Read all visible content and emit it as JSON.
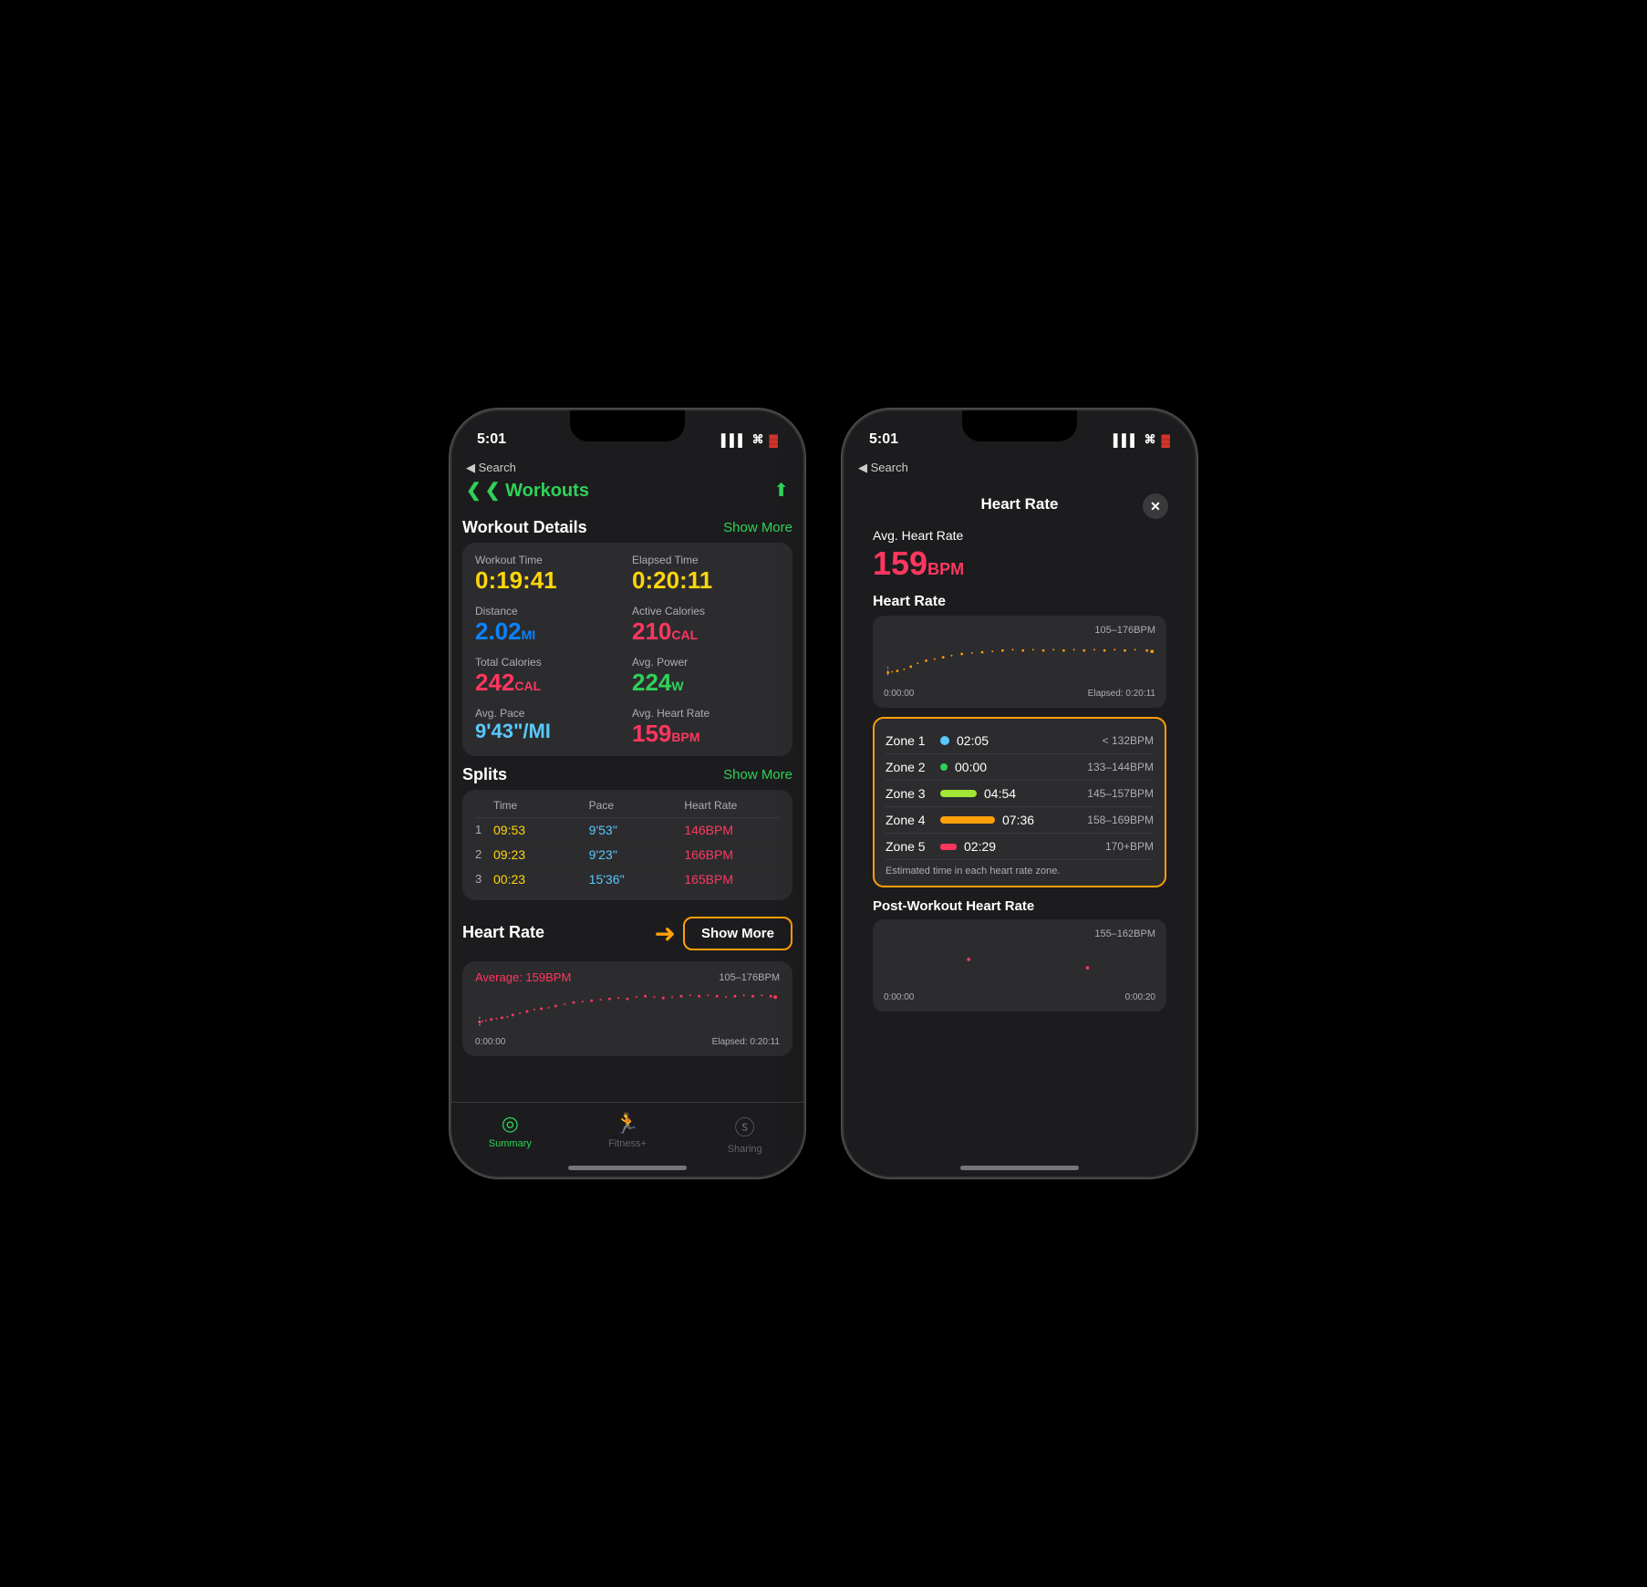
{
  "phone1": {
    "status": {
      "time": "5:01",
      "signal": "▌▌▌",
      "wifi": "WiFi",
      "battery": "🔋"
    },
    "back_nav": "◀ Search",
    "page_title": "❮  Workouts",
    "section_workout": "Workout Details",
    "show_more_workout": "Show More",
    "metrics": [
      {
        "label": "Workout Time",
        "value": "0:19:41",
        "color": "yellow"
      },
      {
        "label": "Elapsed Time",
        "value": "0:20:11",
        "color": "yellow"
      },
      {
        "label": "Distance",
        "value": "2.02",
        "unit": "MI",
        "color": "blue"
      },
      {
        "label": "Active Calories",
        "value": "210",
        "unit": "CAL",
        "color": "pink"
      },
      {
        "label": "Total Calories",
        "value": "242",
        "unit": "CAL",
        "color": "pink"
      },
      {
        "label": "Avg. Power",
        "value": "224",
        "unit": "W",
        "color": "green"
      },
      {
        "label": "Avg. Pace",
        "value": "9'43\"/MI",
        "color": "teal"
      },
      {
        "label": "Avg. Heart Rate",
        "value": "159",
        "unit": "BPM",
        "color": "pink"
      }
    ],
    "section_splits": "Splits",
    "show_more_splits": "Show More",
    "splits_headers": [
      "",
      "Time",
      "Pace",
      "Heart Rate"
    ],
    "splits": [
      {
        "num": "1",
        "time": "09:53",
        "pace": "9'53''",
        "hr": "146BPM"
      },
      {
        "num": "2",
        "time": "09:23",
        "pace": "9'23''",
        "hr": "166BPM"
      },
      {
        "num": "3",
        "time": "00:23",
        "pace": "15'36''",
        "hr": "165BPM"
      }
    ],
    "section_hr": "Heart Rate",
    "show_more_hr": "Show More",
    "hr_avg_label": "Average: 159BPM",
    "hr_range": "105–176BPM",
    "chart_start": "0:00:00",
    "chart_end": "Elapsed: 0:20:11",
    "tabs": [
      {
        "label": "Summary",
        "icon": "⊙",
        "active": true
      },
      {
        "label": "Fitness+",
        "icon": "🏃",
        "active": false
      },
      {
        "label": "Sharing",
        "icon": "S",
        "active": false
      }
    ]
  },
  "phone2": {
    "status": {
      "time": "5:01",
      "signal": "▌▌▌",
      "wifi": "WiFi",
      "battery": "🔋"
    },
    "back_nav": "◀ Search",
    "modal_title": "Heart Rate",
    "avg_hr_label": "Avg. Heart Rate",
    "avg_hr_value": "159",
    "avg_hr_unit": "BPM",
    "section_hr": "Heart Rate",
    "hr_chart_range": "105–176BPM",
    "chart_start": "0:00:00",
    "chart_elapsed": "Elapsed: 0:20:11",
    "zones": [
      {
        "name": "Zone 1",
        "type": "dot",
        "color": "blue",
        "time": "02:05",
        "bpm": "< 132BPM"
      },
      {
        "name": "Zone 2",
        "type": "dot",
        "color": "green",
        "time": "00:00",
        "bpm": "133–144BPM"
      },
      {
        "name": "Zone 3",
        "type": "bar",
        "color": "lime",
        "time": "04:54",
        "bpm": "145–157BPM"
      },
      {
        "name": "Zone 4",
        "type": "bar",
        "color": "orange",
        "time": "07:36",
        "bpm": "158–169BPM"
      },
      {
        "name": "Zone 5",
        "type": "bar",
        "color": "pink",
        "time": "02:29",
        "bpm": "170+BPM"
      }
    ],
    "zone_note": "Estimated time in each heart rate zone.",
    "post_workout_title": "Post-Workout Heart Rate",
    "post_hr_range": "155–162BPM",
    "post_chart_start": "0:00:00",
    "post_chart_end": "0:00:20"
  }
}
